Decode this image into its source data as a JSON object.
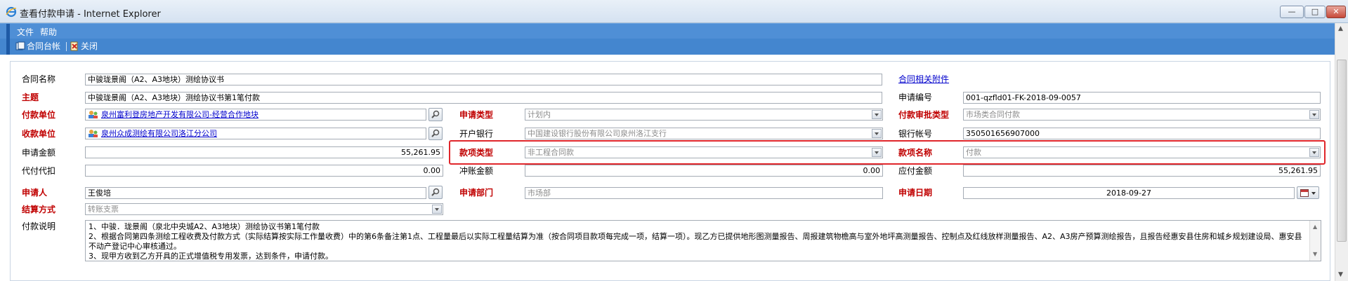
{
  "window": {
    "title": "查看付款申请 - Internet Explorer",
    "min_label": "—",
    "max_label": "□",
    "close_label": "✕"
  },
  "menu": {
    "items": [
      "文件",
      "帮助"
    ]
  },
  "toolbar": {
    "contract_ledger": "合同台帐",
    "close": "关闭"
  },
  "form": {
    "contract_name": {
      "label": "合同名称",
      "value": "中骏珑景阁（A2、A3地块）测绘协议书"
    },
    "subject": {
      "label": "主题",
      "value": "中骏珑景阁（A2、A3地块）测绘协议书第1笔付款"
    },
    "payer": {
      "label": "付款单位",
      "value": "泉州富利登房地产开发有限公司-经营合作地块"
    },
    "payee": {
      "label": "收款单位",
      "value": "泉州众成测绘有限公司洛江分公司"
    },
    "apply_amount": {
      "label": "申请金额",
      "value": "55,261.95"
    },
    "agent_pay": {
      "label": "代付代扣",
      "value": "0.00"
    },
    "applicant": {
      "label": "申请人",
      "value": "王俊培"
    },
    "settle_method": {
      "label": "结算方式",
      "value": "转账支票"
    },
    "pay_note": {
      "label": "付款说明",
      "lines": [
        "1、中骏．珑景阁（泉北中央城A2、A3地块）测绘协议书第1笔付款",
        "2、根据合同第四条测绘工程收费及付款方式（实际结算按实际工作量收费）中的第6条备注第1点、工程量最后以实际工程量结算为准（按合同项目款项每完成一项，结算一项）。现乙方已提供地形图测量报告、周报建筑物檐高与室外地坪高测量报告、控制点及红线放样测量报告、A2、A3房产预算测绘报告，且报告经惠安县住房和城乡规划建设局、惠安县不动产登记中心审核通过。",
        "3、现甲方收到乙方开具的正式增值税专用发票，达到条件，申请付款。"
      ]
    },
    "apply_type": {
      "label": "申请类型",
      "value": "计划内"
    },
    "bank": {
      "label": "开户银行",
      "value": "中国建设银行股份有限公司泉州洛江支行"
    },
    "item_type": {
      "label": "款项类型",
      "value": "非工程合同款"
    },
    "offset_amount": {
      "label": "冲账金额",
      "value": "0.00"
    },
    "apply_dept": {
      "label": "申请部门",
      "value": "市场部"
    },
    "contract_attachment": {
      "label": "合同相关附件"
    },
    "apply_no": {
      "label": "申请编号",
      "value": "001-qzfld01-FK-2018-09-0057"
    },
    "approval_type": {
      "label": "付款审批类型",
      "value": "市场类合同付款"
    },
    "bank_account": {
      "label": "银行帐号",
      "value": "350501656907000"
    },
    "item_name": {
      "label": "款项名称",
      "value": "付款"
    },
    "payable_amount": {
      "label": "应付金额",
      "value": "55,261.95"
    },
    "apply_date": {
      "label": "申请日期",
      "value": "2018-09-27"
    }
  }
}
